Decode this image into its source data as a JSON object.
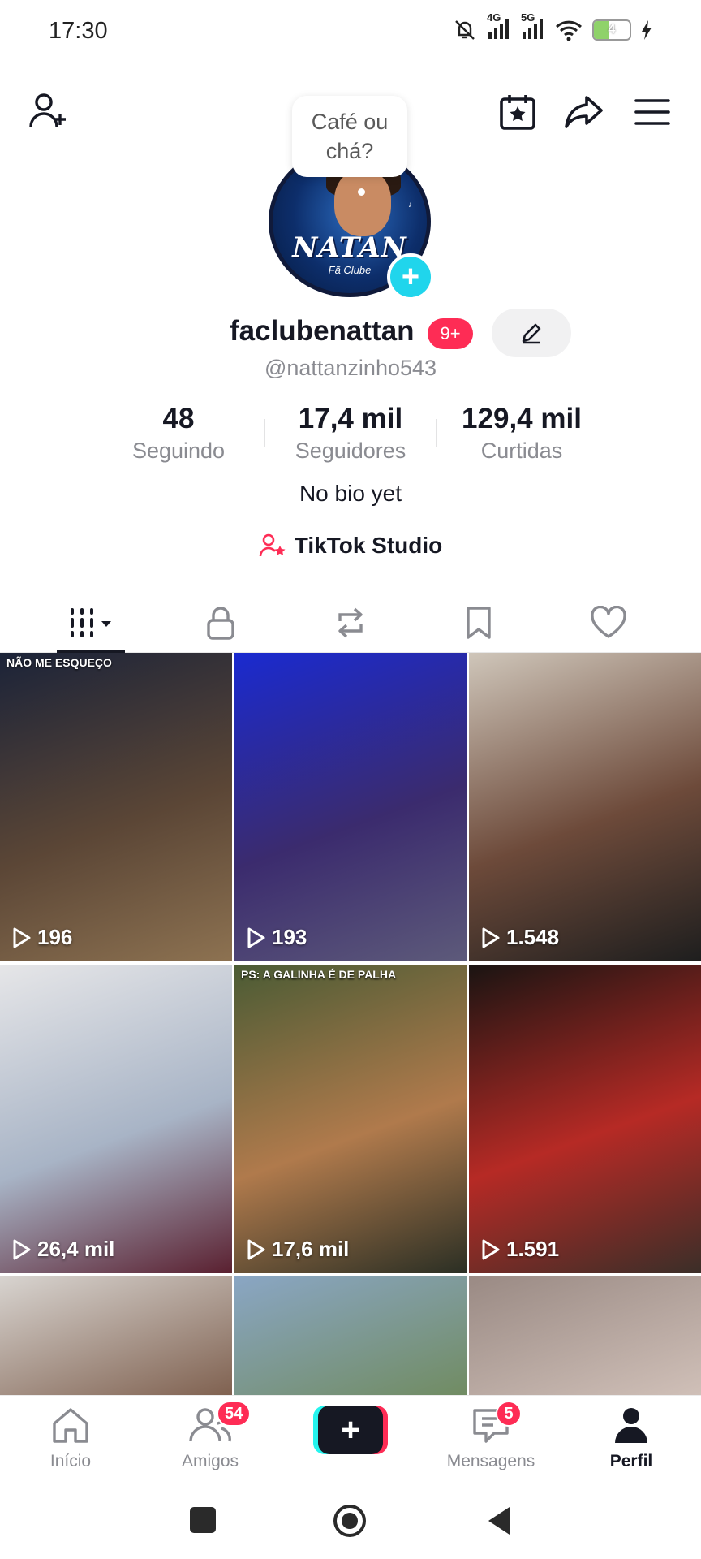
{
  "status_bar": {
    "time": "17:30",
    "net1": "4G",
    "net2": "5G",
    "battery": "4"
  },
  "profile": {
    "bubble_text": "Café ou chá?",
    "avatar_text": "NATAN",
    "avatar_subtext": "Fã Clube",
    "username": "faclubenattan",
    "badge": "9+",
    "handle": "@nattanzinho543",
    "bio": "No bio yet",
    "studio_label": "TikTok Studio"
  },
  "stats": [
    {
      "value": "48",
      "label": "Seguindo"
    },
    {
      "value": "17,4 mil",
      "label": "Seguidores"
    },
    {
      "value": "129,4 mil",
      "label": "Curtidas"
    }
  ],
  "videos": [
    {
      "views": "196",
      "caption": "NÃO ME ESQUEÇO",
      "colors": [
        "#1b2338",
        "#5b4636",
        "#8d7251"
      ]
    },
    {
      "views": "193",
      "caption": "",
      "colors": [
        "#1a2ad0",
        "#3b2b6e",
        "#5d5a7a"
      ]
    },
    {
      "views": "1.548",
      "caption": "",
      "colors": [
        "#cfc6ba",
        "#6d4a3a",
        "#1e1e1e"
      ]
    },
    {
      "views": "26,4 mil",
      "caption": "",
      "colors": [
        "#e6e6e8",
        "#a8b4c6",
        "#5a2030"
      ]
    },
    {
      "views": "17,6 mil",
      "caption": "PS: A GALINHA É DE PALHA",
      "colors": [
        "#4a5b34",
        "#b07a4c",
        "#2b2f24"
      ]
    },
    {
      "views": "1.591",
      "caption": "",
      "colors": [
        "#1a1412",
        "#b62a25",
        "#3b2e28"
      ]
    },
    {
      "views": "",
      "caption": "",
      "colors": [
        "#d8d4d0",
        "#7a5a48",
        "#3b3b3b"
      ]
    },
    {
      "views": "",
      "caption": "",
      "colors": [
        "#8aa6c4",
        "#6f8a5c",
        "#3a3d3f"
      ]
    },
    {
      "views": "",
      "caption": "",
      "colors": [
        "#9a8a84",
        "#d3c3bb",
        "#4a3a36"
      ]
    }
  ],
  "bottom_nav": {
    "home": "Início",
    "friends": "Amigos",
    "friends_badge": "54",
    "messages": "Mensagens",
    "messages_badge": "5",
    "profile": "Perfil"
  }
}
